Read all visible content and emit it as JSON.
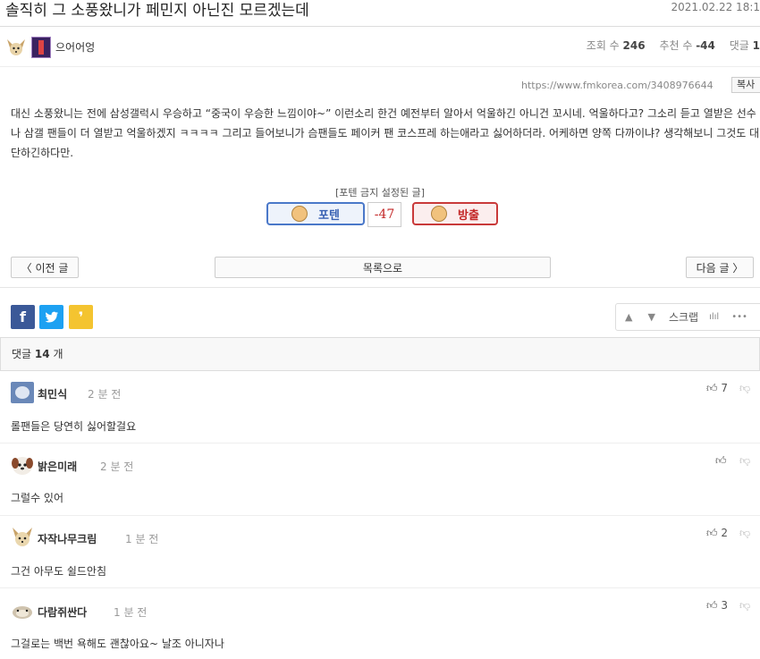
{
  "post": {
    "title": "솔직히 그 소풍왔니가 페민지 아닌진 모르겠는데",
    "date": "2021.02.22 18:1",
    "author": "으어어엉",
    "views_label": "조회 수",
    "views": "246",
    "recommend_label": "추천 수",
    "recommend": "-44",
    "comments_label": "댓글",
    "comments": "1",
    "url": "https://www.fmkorea.com/3408976644",
    "copy_label": "복사",
    "body": "대신 소풍왔니는 전에 삼성갤럭시 우승하고 “중국이 우승한 느낌이야~” 이런소리 한건 예전부터 알아서 억울하긴 아니건 꼬시네. 억울하다고? 그소리 듣고 열받은 선수나 삼갤 팬들이 더 열받고 억울하겠지 ㅋㅋㅋㅋ 그리고 들어보니가 슴팬들도 페이커 팬 코스프레 하는애라고 싫어하더라. 어케하면 양쪽 다까이냐? 생각해보니 그것도 대단하긴하다만."
  },
  "vote": {
    "banned_label": "[포텐 금지 설정된 글]",
    "up_label": "포텐",
    "count": "-47",
    "down_label": "방출"
  },
  "nav": {
    "prev_label": "〈 이전 글",
    "list_label": "목록으로",
    "next_label": "다음 글 〉"
  },
  "share": {
    "facebook": "f",
    "twitter": "t",
    "kakao": "❜"
  },
  "toolbar": {
    "up_icon": "▲",
    "down_icon": "▼",
    "scrap_label": "스크랩",
    "chart_icon": "ılıl",
    "more_icon": "•••"
  },
  "comments_header": {
    "label": "댓글",
    "count": "14",
    "unit": "개"
  },
  "comments": [
    {
      "name": "최민식",
      "time": "2 분 전",
      "text": "롤팬들은 당연히 싫어할걸요",
      "likes": "7",
      "avatar_color": "#6a88b8"
    },
    {
      "name": "밝은미래",
      "time": "2 분 전",
      "text": "그럴수 있어",
      "likes": "",
      "avatar_color": "#a05a3a"
    },
    {
      "name": "자작나무크림",
      "time": "1 분 전",
      "text": "그건 아무도 쉴드안침",
      "likes": "2",
      "avatar_color": "#c8a060"
    },
    {
      "name": "다람쥐싼다",
      "time": "1 분 전",
      "text": "그걸로는 백번 욕해도 괜찮아요~ 날조 아니자나",
      "likes": "3",
      "avatar_color": "#b8a890"
    }
  ],
  "colors": {
    "facebook": "#3b5998",
    "twitter": "#1da1f2",
    "kakao": "#f4c430",
    "potten_blue": "#4a78c9",
    "bangchul_red": "#c93a3a"
  }
}
